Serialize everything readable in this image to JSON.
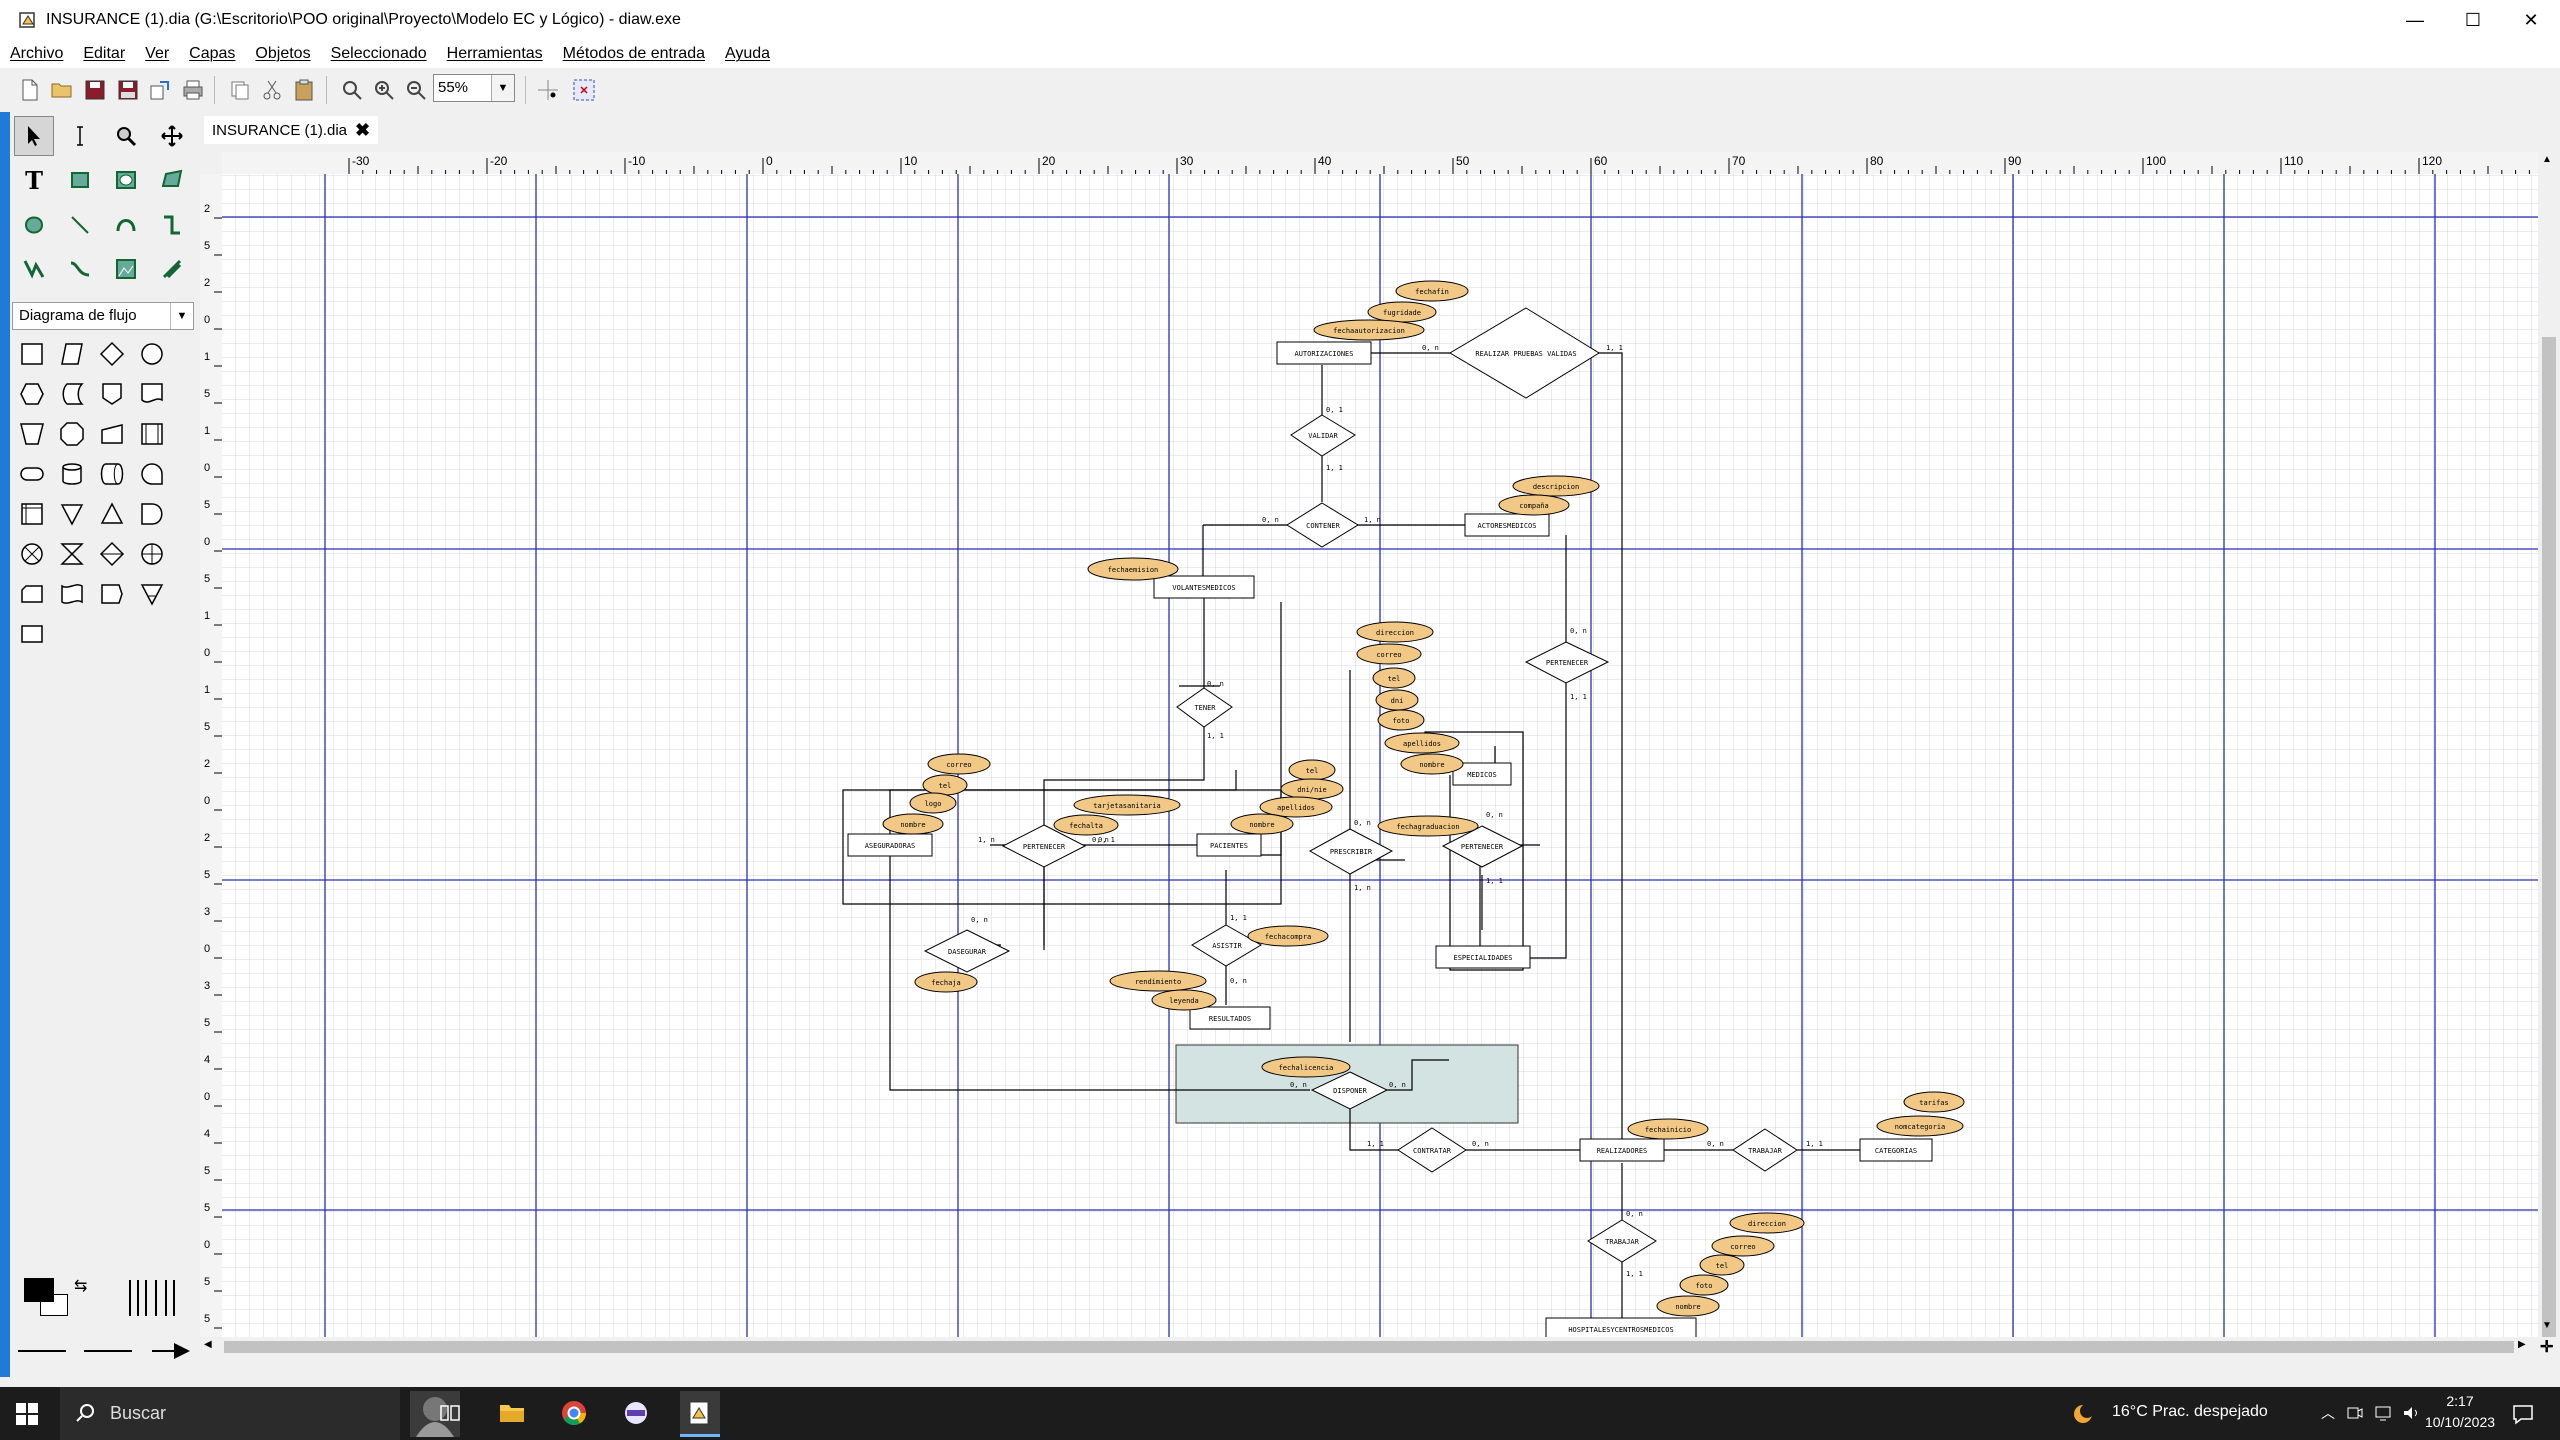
{
  "window": {
    "title": "INSURANCE (1).dia (G:\\Escritorio\\POO original\\Proyecto\\Modelo EC y Lógico) - diaw.exe",
    "minimize": "—",
    "maximize": "☐",
    "close": "✕"
  },
  "menu": [
    "Archivo",
    "Editar",
    "Ver",
    "Capas",
    "Objetos",
    "Seleccionado",
    "Herramientas",
    "Métodos de entrada",
    "Ayuda"
  ],
  "toolbar": {
    "zoom_value": "55%"
  },
  "toolbox": {
    "sheet": "Diagrama de flujo"
  },
  "tabs": [
    {
      "label": "INSURANCE (1).dia",
      "close": "✖"
    }
  ],
  "ruler": {
    "top_ticks": [
      "-30",
      "-20",
      "-10",
      "0",
      "10",
      "20",
      "30",
      "40",
      "50",
      "60",
      "70",
      "80",
      "90",
      "100",
      "110",
      "120"
    ],
    "left_ticks": [
      "2",
      "5",
      "2",
      "0",
      "1",
      "5",
      "1",
      "0",
      "5",
      "0",
      "5",
      "1",
      "0",
      "1",
      "5",
      "2",
      "0",
      "2",
      "5",
      "3",
      "0",
      "3",
      "5",
      "4",
      "0",
      "4",
      "5",
      "5",
      "0",
      "5",
      "5"
    ]
  },
  "diagram": {
    "entities": {
      "autorizaciones": "AUTORIZACIONES",
      "actoresmedicos": "ACTORESMEDICOS",
      "volantesmedicos": "VOLANTESMEDICOS",
      "aseguradoras": "ASEGURADORAS",
      "pacientes": "PACIENTES",
      "medicos": "MEDICOS",
      "especialidades": "ESPECIALIDADES",
      "resultados": "RESULTADOS",
      "realizadores": "REALIZADORES",
      "categorias": "CATEGORIAS",
      "hospitals": "HOSPITALESYCENTROSMEDICOS"
    },
    "relations": {
      "realizar": "REALIZAR PRUEBAS VALIDAS",
      "validar": "VALIDAR",
      "contener": "CONTENER",
      "pertenecer1": "PERTENECER",
      "tener": "TENER",
      "pertenecer2": "PERTENECER",
      "prescribir": "PRESCRIBIR",
      "pertenecer3": "PERTENECER",
      "dasegurar": "DASEGURAR",
      "asistir": "ASISTIR",
      "disponer": "DISPONER",
      "contratar": "CONTRATAR",
      "trabajar1": "TRABAJAR",
      "trabajar2": "TRABAJAR"
    },
    "attributes": {
      "a1": "fechafin",
      "a2": "fugridade",
      "a3": "fechaautorizacion",
      "a4": "descripcion",
      "a5": "compaña",
      "a6": "fechaemision",
      "a7": "direccion",
      "a8": "correo",
      "a9": "tel",
      "a10": "dni",
      "a11": "foto",
      "a12": "apellidos",
      "a13": "nombre",
      "a14": "correo",
      "a15": "tel",
      "a16": "logo",
      "a17": "nombre",
      "a18": "tel",
      "a19": "dni/nie",
      "a20": "apellidos",
      "a21": "nombre",
      "a22": "tarjetasanitaria",
      "a23": "fechalta",
      "a24": "fechagraduacion",
      "a25": "fechaja",
      "a26": "fechacompra",
      "a27": "rendimiento",
      "a28": "leyenda",
      "a29": "fechalicencia",
      "a30": "fechainicio",
      "a31": "tarifas",
      "a32": "nomcategoria",
      "a33": "direccion",
      "a34": "correo",
      "a35": "tel",
      "a36": "foto",
      "a37": "nombre"
    },
    "cardinalities": {
      "c1": "0, n",
      "c2": "1, 1",
      "c3": "0, 1",
      "c4": "1, 1",
      "c5": "0, n",
      "c6": "1, n",
      "c7": "0, n",
      "c8": "1, 1",
      "c9": "0, n",
      "c10": "1, 1",
      "c11": "1, n",
      "c12": "0, n",
      "c13": "0, n",
      "c14": "1, n",
      "c15": "0, n",
      "c16": "1, 1",
      "c17": "0, n",
      "c18": "1, 1",
      "c19": "0, n",
      "c20": "0, n",
      "c21": "0, n",
      "c22": "1, 1",
      "c23": "0, n",
      "c24": "0, n",
      "c25": "1, 1",
      "c26": "0, n",
      "c27": "1, 1",
      "c28": "0, 1"
    }
  },
  "taskbar": {
    "search": "Buscar",
    "weather": "16°C  Prac. despejado",
    "time": "2:17",
    "date": "10/10/2023"
  }
}
